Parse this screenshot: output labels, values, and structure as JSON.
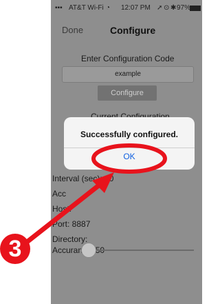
{
  "status_bar": {
    "carrier": "AT&T Wi-Fi",
    "time": "12:07 PM",
    "battery": "97%"
  },
  "nav": {
    "done": "Done",
    "title": "Configure"
  },
  "config_code": {
    "label": "Enter Configuration Code",
    "value": "example",
    "button": "Configure"
  },
  "current": {
    "heading": "Current Configuration"
  },
  "fields": {
    "interval": "Interval (sec): 30",
    "acc": "Acc",
    "host": "Host:",
    "port": "Port: 8887",
    "directory": "Directory:",
    "accuracy": "Accurancy: 50"
  },
  "slider": {
    "value_fraction": 0.0
  },
  "alert": {
    "title": "Successfully configured.",
    "ok": "OK"
  },
  "annotation": {
    "step": "3"
  },
  "colors": {
    "annotation": "#e8131c",
    "link": "#1060e0"
  }
}
